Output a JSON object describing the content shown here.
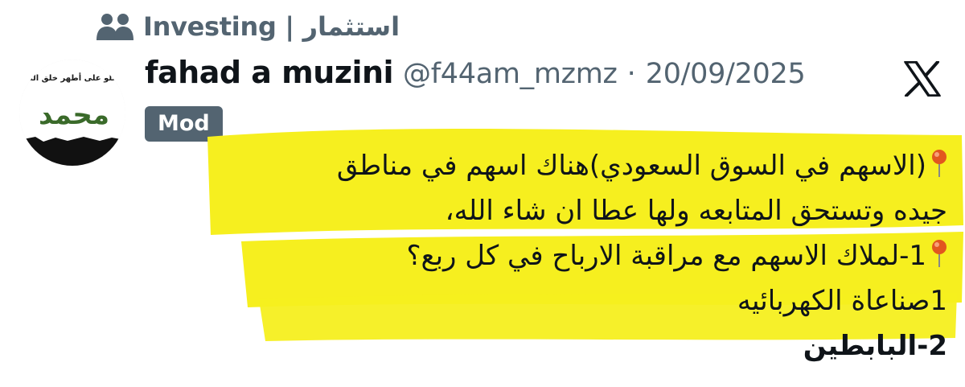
{
  "community": {
    "icon": "community-people-icon",
    "label": "Investing | استثمار"
  },
  "author": {
    "name": "fahad a muzini",
    "handle": "@f44am_mzmz",
    "separator": "·",
    "date": "20/09/2025",
    "avatar_text": "صلو على أطهر خلق الله",
    "avatar_name": "محمد"
  },
  "badge": {
    "label": "Mod"
  },
  "platform": {
    "icon": "x-logo-icon"
  },
  "post": {
    "lines": [
      "(الاسهم في السوق السعودي)هناك اسهم في مناطق",
      "جيده وتستحق المتابعه ولها عطا ان شاء الله،",
      "1-لملاك الاسهم مع مراقبة الارباح في كل ربع؟",
      "1صناعاة الكهربائيه",
      "2-البابطين"
    ],
    "pin_icon": "round-pushpin-icon"
  },
  "colors": {
    "text": "#0f1419",
    "secondary": "#536471",
    "badge_bg": "#536471",
    "highlight": "#f6ef1f",
    "pin": "#e2561f"
  }
}
